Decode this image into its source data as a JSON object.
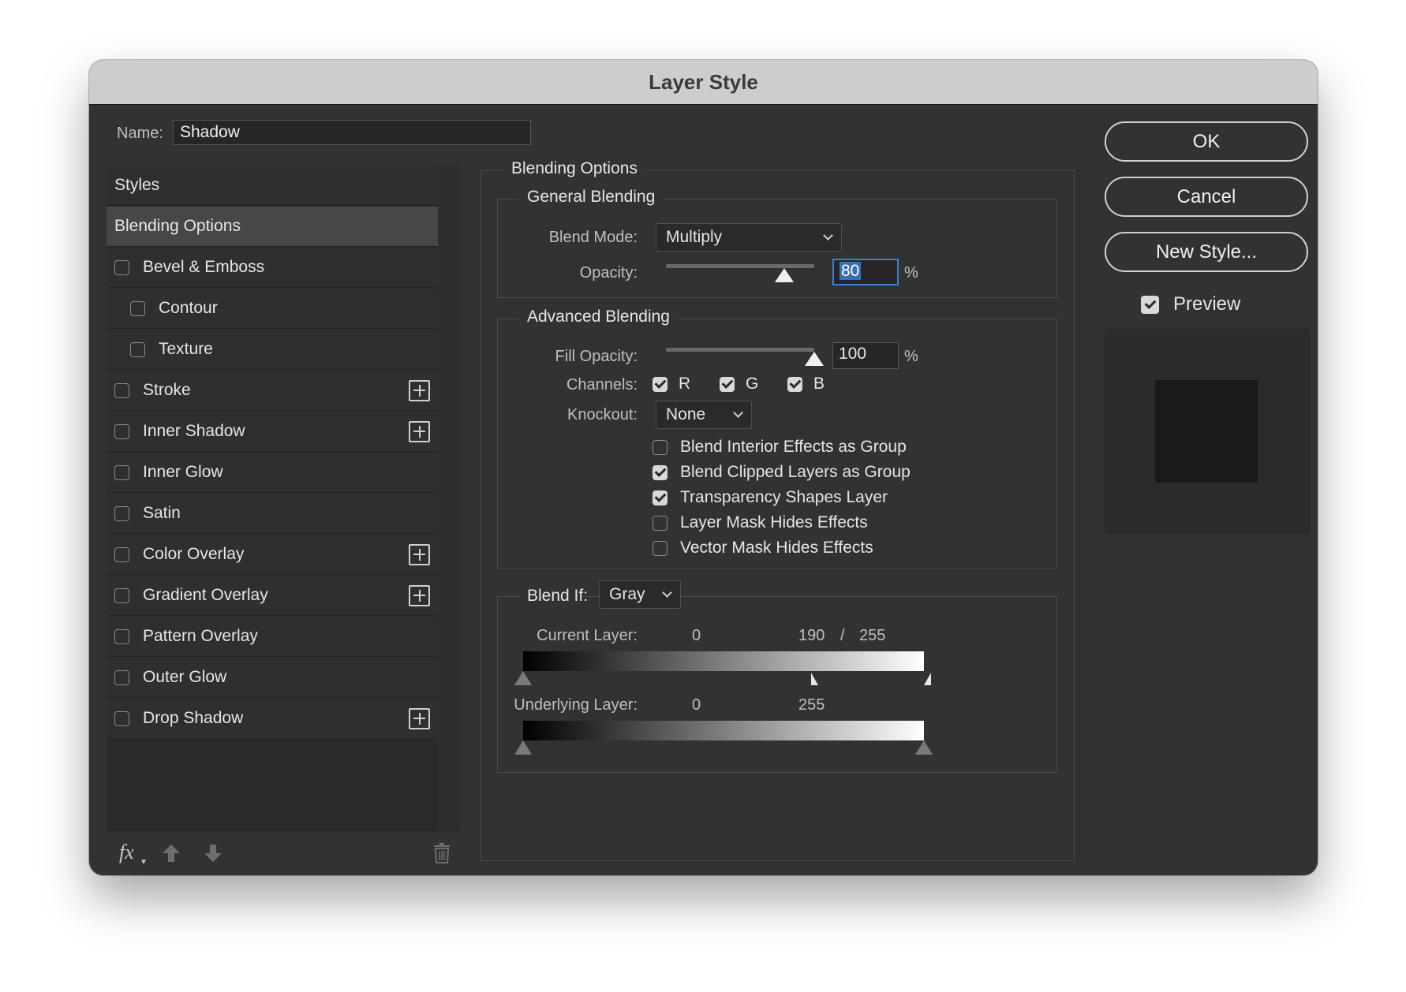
{
  "dialog": {
    "title": "Layer Style",
    "name_label": "Name:",
    "name_value": "Shadow"
  },
  "styles_list": {
    "header": "Styles",
    "selected": "Blending Options",
    "items": [
      {
        "label": "Bevel & Emboss",
        "checked": false,
        "has_plus": false,
        "indent": false
      },
      {
        "label": "Contour",
        "checked": false,
        "has_plus": false,
        "indent": true
      },
      {
        "label": "Texture",
        "checked": false,
        "has_plus": false,
        "indent": true
      },
      {
        "label": "Stroke",
        "checked": false,
        "has_plus": true,
        "indent": false
      },
      {
        "label": "Inner Shadow",
        "checked": false,
        "has_plus": true,
        "indent": false
      },
      {
        "label": "Inner Glow",
        "checked": false,
        "has_plus": false,
        "indent": false
      },
      {
        "label": "Satin",
        "checked": false,
        "has_plus": false,
        "indent": false
      },
      {
        "label": "Color Overlay",
        "checked": false,
        "has_plus": true,
        "indent": false
      },
      {
        "label": "Gradient Overlay",
        "checked": false,
        "has_plus": true,
        "indent": false
      },
      {
        "label": "Pattern Overlay",
        "checked": false,
        "has_plus": false,
        "indent": false
      },
      {
        "label": "Outer Glow",
        "checked": false,
        "has_plus": false,
        "indent": false
      },
      {
        "label": "Drop Shadow",
        "checked": false,
        "has_plus": true,
        "indent": false
      }
    ],
    "footer_icons": [
      "fx-icon",
      "arrow-up-icon",
      "arrow-down-icon",
      "trash-icon"
    ],
    "fx_label": "fx"
  },
  "blending_options": {
    "title": "Blending Options",
    "general": {
      "title": "General Blending",
      "blend_mode_label": "Blend Mode:",
      "blend_mode_value": "Multiply",
      "opacity_label": "Opacity:",
      "opacity_value": "80",
      "opacity_fraction": 0.8,
      "percent": "%"
    },
    "advanced": {
      "title": "Advanced Blending",
      "fill_opacity_label": "Fill Opacity:",
      "fill_opacity_value": "100",
      "fill_opacity_fraction": 1.0,
      "percent": "%",
      "channels_label": "Channels:",
      "channels": [
        {
          "label": "R",
          "checked": true
        },
        {
          "label": "G",
          "checked": true
        },
        {
          "label": "B",
          "checked": true
        }
      ],
      "knockout_label": "Knockout:",
      "knockout_value": "None",
      "options": [
        {
          "label": "Blend Interior Effects as Group",
          "checked": false
        },
        {
          "label": "Blend Clipped Layers as Group",
          "checked": true
        },
        {
          "label": "Transparency Shapes Layer",
          "checked": true
        },
        {
          "label": "Layer Mask Hides Effects",
          "checked": false
        },
        {
          "label": "Vector Mask Hides Effects",
          "checked": false
        }
      ]
    },
    "blend_if": {
      "label": "Blend If:",
      "value": "Gray",
      "current_layer_label": "Current Layer:",
      "current_low": "0",
      "current_high_split": "190",
      "separator": "/",
      "current_high": "255",
      "underlying_layer_label": "Underlying Layer:",
      "underlying_low": "0",
      "underlying_high": "255"
    }
  },
  "buttons": {
    "ok": "OK",
    "cancel": "Cancel",
    "new_style": "New Style...",
    "preview_label": "Preview",
    "preview_checked": true
  },
  "colors": {
    "dialog_bg": "#323232",
    "selected_row": "#474747",
    "focus": "#3d7bd9"
  }
}
